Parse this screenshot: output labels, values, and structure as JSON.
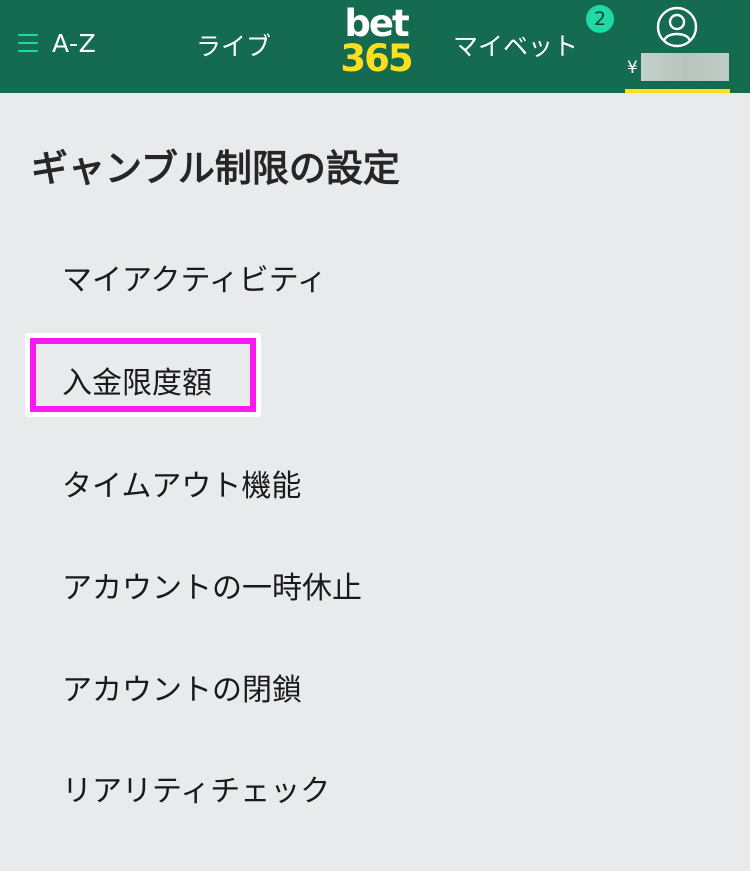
{
  "header": {
    "menu_label": "A-Z",
    "live_label": "ライブ",
    "logo_top": "bet",
    "logo_bottom": "365",
    "my_bets_label": "マイベット",
    "my_bets_count": "2",
    "currency_symbol": "¥"
  },
  "page": {
    "title": "ギャンブル制限の設定"
  },
  "menu": {
    "items": [
      "マイアクティビティ",
      "入金限度額",
      "タイムアウト機能",
      "アカウントの一時休止",
      "アカウントの閉鎖",
      "リアリティチェック"
    ]
  },
  "colors": {
    "header_bg": "#146b4f",
    "accent_green": "#1fd9a6",
    "brand_yellow": "#ffdf1b",
    "highlight_magenta": "#f81af0",
    "page_bg": "#e9eaec"
  }
}
